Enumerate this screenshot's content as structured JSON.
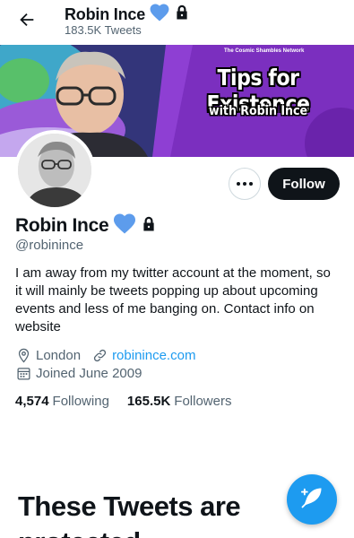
{
  "header": {
    "title": "Robin Ince",
    "subtitle": "183.5K Tweets"
  },
  "banner": {
    "brand": "The Cosmic Shambles Network",
    "title": "Tips for Existence",
    "subtitle": "with Robin Ince"
  },
  "profile": {
    "display_name": "Robin Ince",
    "handle": "@robinince",
    "bio": "I am away from my twitter account at the moment, so it will mainly be tweets popping up about upcoming events and less of me banging on. Contact info on website",
    "location": "London",
    "website": "robinince.com",
    "joined": "Joined June 2009",
    "following_count": "4,574",
    "following_label": "Following",
    "followers_count": "165.5K",
    "followers_label": "Followers"
  },
  "actions": {
    "follow_label": "Follow"
  },
  "protected_notice": {
    "heading": "These Tweets are protected"
  },
  "icons": {
    "back": "arrow-left-icon",
    "heart": "blue-heart-icon",
    "lock": "lock-icon",
    "more": "more-icon",
    "location": "location-pin-icon",
    "link": "link-icon",
    "calendar": "calendar-icon",
    "compose": "compose-tweet-icon"
  },
  "colors": {
    "accent": "#1d9bf0",
    "text": "#0f1419",
    "secondary": "#536471",
    "heart": "#5d9cec",
    "banner_purple": "#7b2fbf"
  }
}
